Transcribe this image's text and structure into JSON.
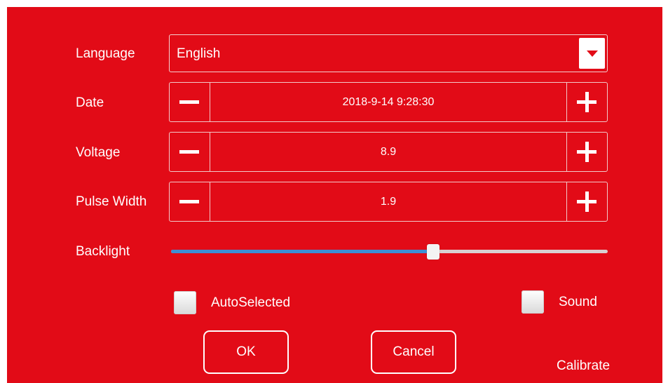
{
  "settings": {
    "language": {
      "label": "Language",
      "value": "English",
      "arrow_icon": "caret-down-icon"
    },
    "date": {
      "label": "Date",
      "value": "2018-9-14 9:28:30"
    },
    "voltage": {
      "label": "Voltage",
      "value": "8.9"
    },
    "pulse_width": {
      "label": "Pulse Width",
      "value": "1.9"
    },
    "backlight": {
      "label": "Backlight",
      "level": 0.6
    }
  },
  "options": {
    "auto_selected": {
      "label": "AutoSelected",
      "checked": false
    },
    "sound": {
      "label": "Sound",
      "checked": false
    }
  },
  "buttons": {
    "ok": "OK",
    "cancel": "Cancel",
    "calibrate": "Calibrate"
  },
  "colors": {
    "background": "#e20b17",
    "slider_fill": "#3e8ed4",
    "text": "#ffffff"
  }
}
